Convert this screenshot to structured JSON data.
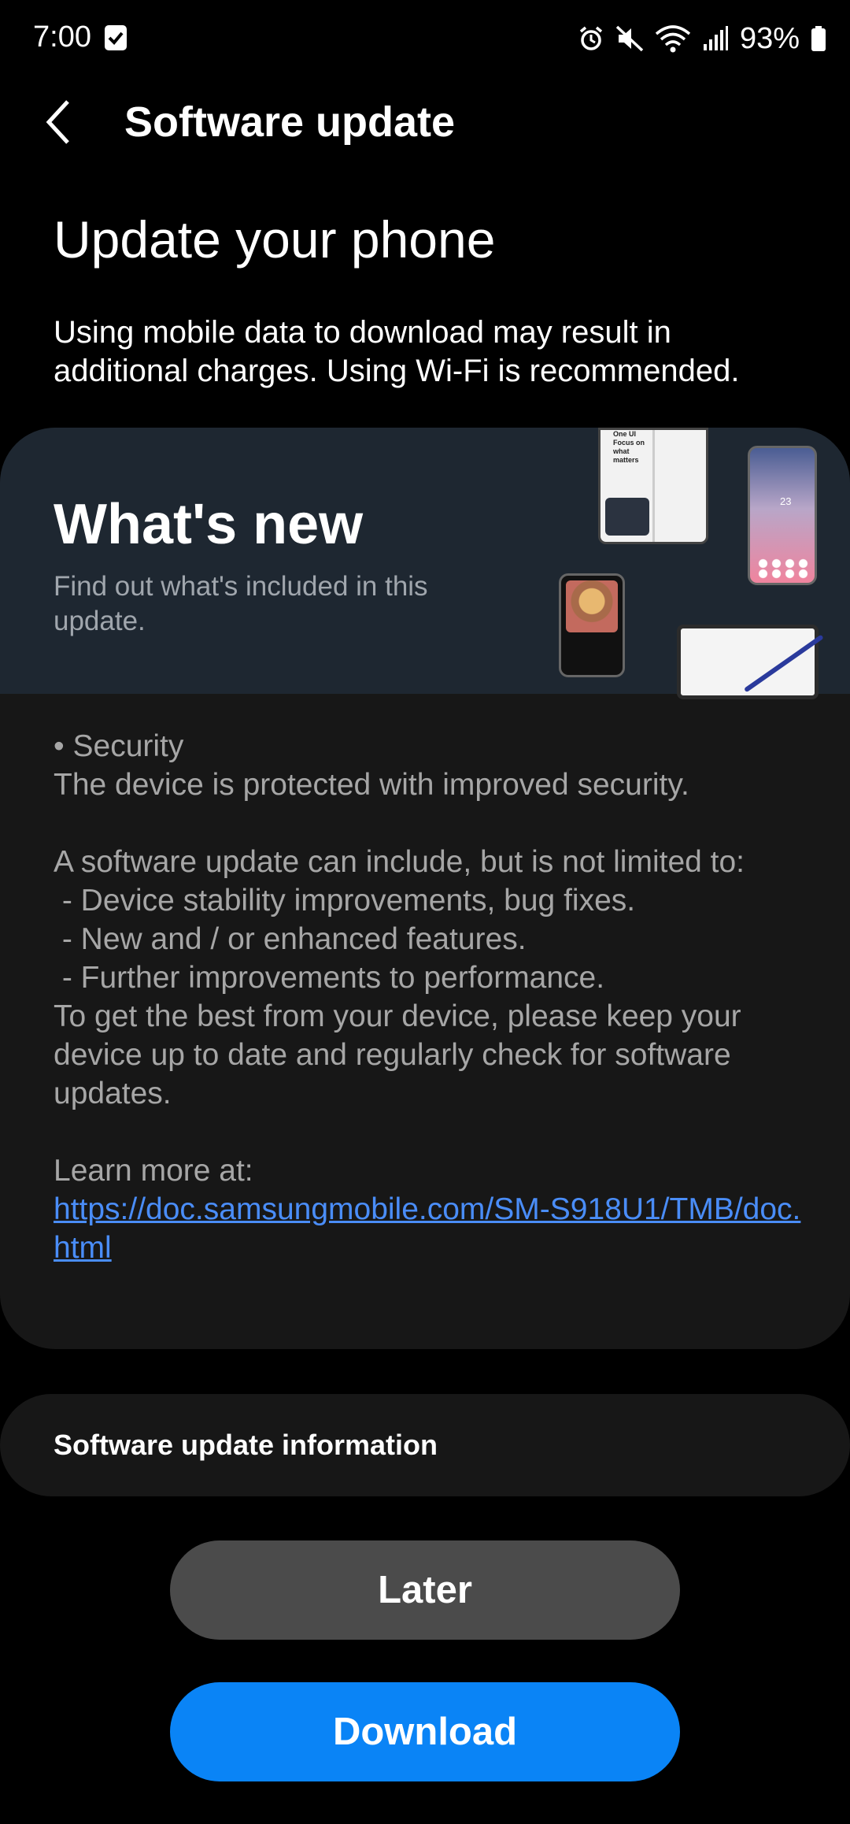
{
  "status_bar": {
    "time": "7:00",
    "battery": "93%",
    "icons": [
      "checkbox-icon",
      "alarm-icon",
      "mute-icon",
      "wifi-icon",
      "signal-icon",
      "battery-icon"
    ]
  },
  "header": {
    "back_icon": "chevron-left-icon",
    "title": "Software update"
  },
  "main": {
    "title": "Update your phone",
    "notice": "Using mobile data to download may result in additional charges. Using Wi-Fi is recommended."
  },
  "whats_new": {
    "heading": "What's new",
    "subtitle": "Find out what's included in this update.",
    "promo_lines": [
      "One UI",
      "Focus on what matters"
    ],
    "promo_phone_number": "23",
    "body": "• Security\nThe device is protected with improved security.\n\nA software update can include, but is not limited to:\n - Device stability improvements, bug fixes.\n - New and / or enhanced features.\n - Further improvements to performance.\nTo get the best from your device, please keep your device up to date and regularly check for software updates.\n\nLearn more at:",
    "link": "https://doc.samsungmobile.com/SM-S918U1/TMB/doc.html"
  },
  "info": {
    "label": "Software update information"
  },
  "buttons": {
    "later": "Later",
    "download": "Download"
  },
  "colors": {
    "background": "#000000",
    "card": "#171717",
    "banner": "#1e2731",
    "link": "#4a8df8",
    "download_button": "#0a84f6",
    "later_button": "#4b4b4b"
  }
}
